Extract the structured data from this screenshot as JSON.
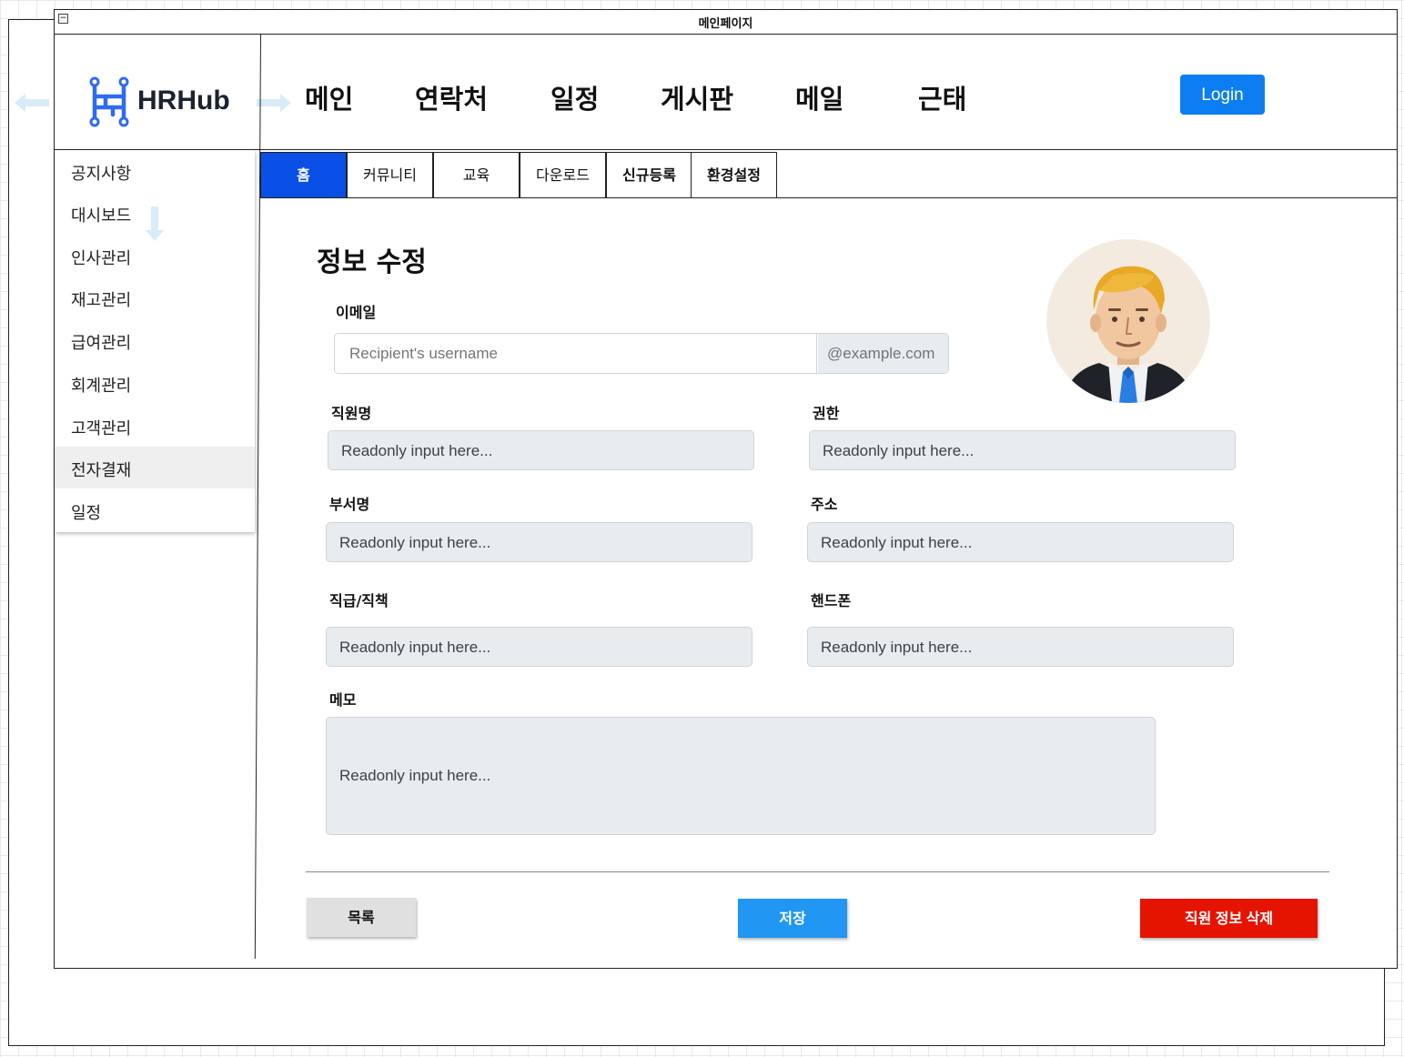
{
  "window": {
    "title": "메인페이지",
    "collapse_symbol": "−"
  },
  "brand": {
    "name": "HRHub",
    "icon": "hrhub-logo-icon",
    "color": "#2f6bf0"
  },
  "nav": {
    "items": [
      "메인",
      "연락처",
      "일정",
      "게시판",
      "메일",
      "근태"
    ],
    "login_label": "Login",
    "login_color": "#0d7ef2"
  },
  "sidebar": {
    "items": [
      {
        "label": "공지사항"
      },
      {
        "label": "대시보드"
      },
      {
        "label": "인사관리"
      },
      {
        "label": "재고관리"
      },
      {
        "label": "급여관리"
      },
      {
        "label": "회계관리"
      },
      {
        "label": "고객관리"
      },
      {
        "label": "전자결재",
        "active": true
      },
      {
        "label": "일정"
      }
    ]
  },
  "tabs": [
    {
      "label": "홈",
      "active": true
    },
    {
      "label": "커뮤니티"
    },
    {
      "label": "교육"
    },
    {
      "label": "다운로드"
    },
    {
      "label": "신규등록"
    },
    {
      "label": "환경설정"
    }
  ],
  "form": {
    "title": "정보 수정",
    "email": {
      "label": "이메일",
      "placeholder": "Recipient's username",
      "addon": "@example.com"
    },
    "fields": {
      "name": {
        "label": "직원명",
        "value": "Readonly input here..."
      },
      "role": {
        "label": "권한",
        "value": "Readonly input here..."
      },
      "dept": {
        "label": "부서명",
        "value": "Readonly input here..."
      },
      "address": {
        "label": "주소",
        "value": "Readonly input here..."
      },
      "position": {
        "label": "직급/직책",
        "value": "Readonly input here..."
      },
      "phone": {
        "label": "핸드폰",
        "value": "Readonly input here..."
      },
      "memo": {
        "label": "메모",
        "value": "Readonly input here..."
      }
    },
    "avatar": "user-avatar-icon"
  },
  "actions": {
    "list_label": "목록",
    "save_label": "저장",
    "delete_label": "직원 정보 삭제",
    "save_color": "#2196f3",
    "delete_color": "#e51400"
  }
}
